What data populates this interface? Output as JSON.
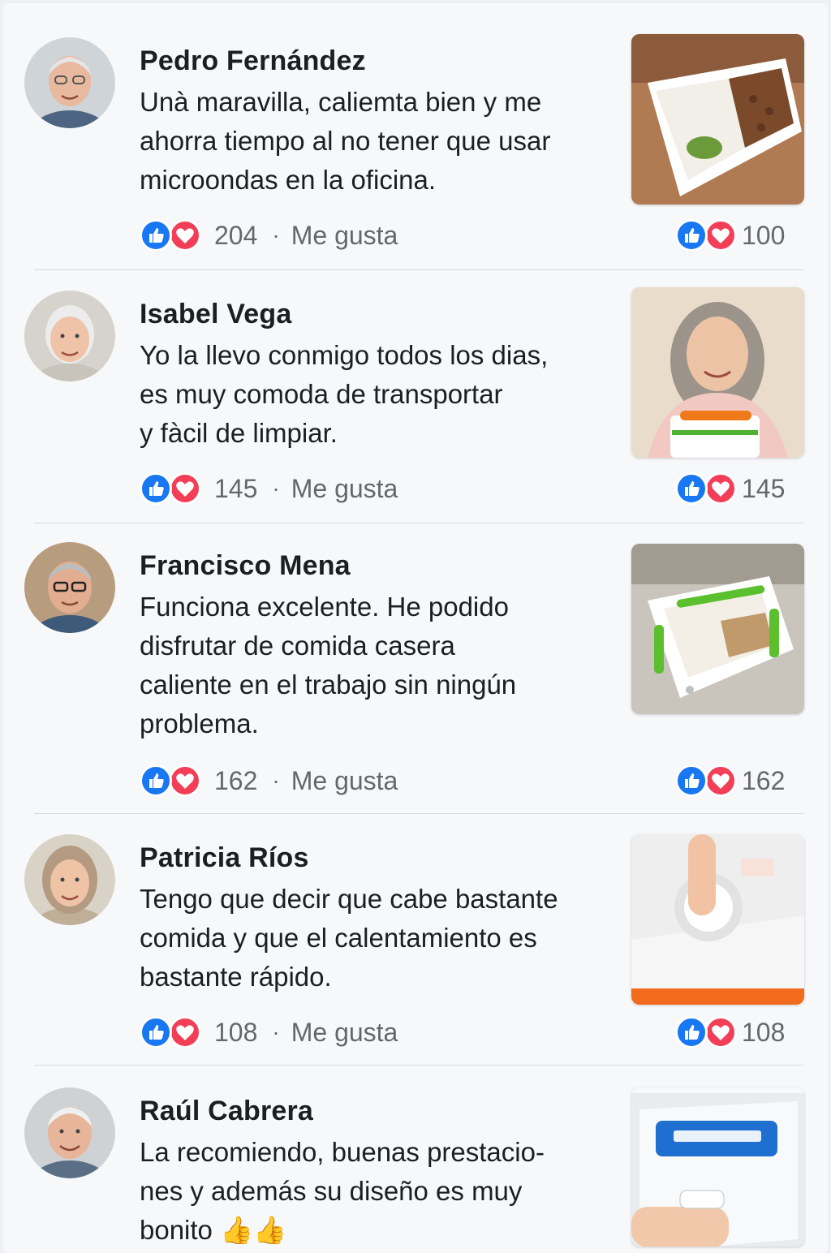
{
  "comments": [
    {
      "name": "Pedro Fernández",
      "lines": [
        "Unà maravilla, caliemta bien y me",
        "ahorra tiempo al no tener que usar",
        "microondas en la oficina."
      ],
      "reaction_count": "204",
      "separator": "·",
      "like_label": "Me gusta",
      "photo_reaction_count": "100",
      "avatar_icon": "older-man-avatar",
      "photo_icon": "lunchbox-food-photo"
    },
    {
      "name": "Isabel Vega",
      "lines": [
        "Yo la llevo conmigo todos los dias,",
        "es muy comoda de transportar",
        "y fàcil de limpiar."
      ],
      "reaction_count": "145",
      "separator": "·",
      "like_label": "Me gusta",
      "photo_reaction_count": "145",
      "avatar_icon": "older-woman-avatar",
      "photo_icon": "woman-holding-lunchbox-photo"
    },
    {
      "name": "Francisco Mena",
      "lines": [
        "Funciona excelente. He podido",
        "disfrutar de comida casera",
        "caliente en el trabajo sin ningún",
        "problema."
      ],
      "reaction_count": "162",
      "separator": "·",
      "like_label": "Me gusta",
      "photo_reaction_count": "162",
      "avatar_icon": "older-man-glasses-avatar",
      "photo_icon": "green-lunchbox-photo"
    },
    {
      "name": "Patricia Ríos",
      "lines": [
        "Tengo que decir que cabe bastante",
        "comida y que el calentamiento es",
        "bastante rápido."
      ],
      "reaction_count": "108",
      "separator": "·",
      "like_label": "Me gusta",
      "photo_reaction_count": "108",
      "avatar_icon": "older-woman-avatar",
      "photo_icon": "finger-pressing-button-photo"
    },
    {
      "name": "Raúl Cabrera",
      "lines": [
        "La recomiendo, buenas prestacio-",
        "nes y además su diseño es muy",
        "bonito 👍👍"
      ],
      "avatar_icon": "older-man-avatar",
      "photo_icon": "blue-lunchbox-plug-photo"
    }
  ],
  "colors": {
    "like_blue": "#1877f2",
    "love_red": "#f33e58",
    "meta_gray": "#65676b",
    "background": "#f7f8fa"
  }
}
